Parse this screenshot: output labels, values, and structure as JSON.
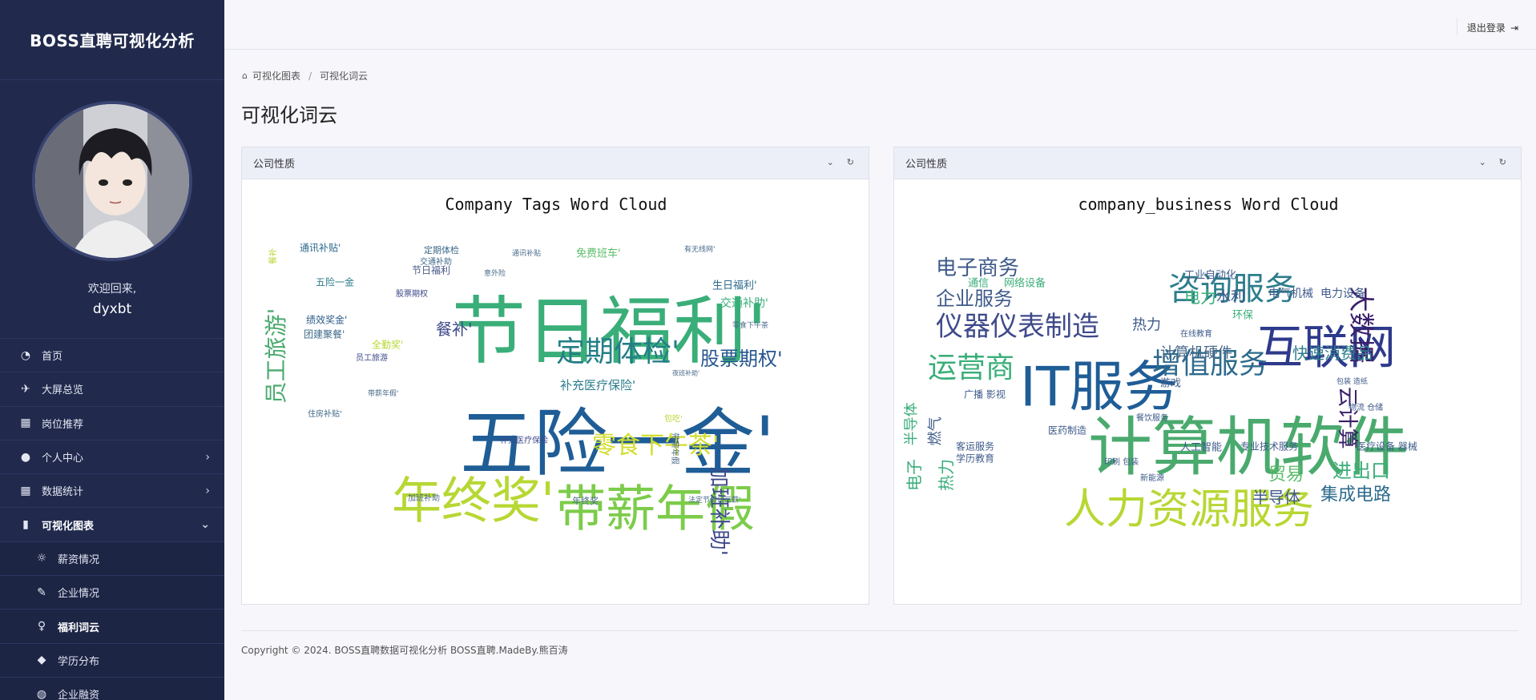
{
  "sidebar": {
    "brand": "BOSS直聘可视化分析",
    "welcome": "欢迎回来,",
    "username": "dyxbt",
    "items": [
      {
        "label": "首页",
        "icon": "dashboard-icon"
      },
      {
        "label": "大屏总览",
        "icon": "plane-icon"
      },
      {
        "label": "岗位推荐",
        "icon": "grid-icon"
      },
      {
        "label": "个人中心",
        "icon": "user-icon"
      },
      {
        "label": "数据统计",
        "icon": "grid-icon"
      },
      {
        "label": "可视化图表",
        "icon": "bar-chart-icon"
      }
    ],
    "subitems": [
      {
        "label": "薪资情况",
        "icon": "sun-icon"
      },
      {
        "label": "企业情况",
        "icon": "feather-icon"
      },
      {
        "label": "福利词云",
        "icon": "lightbulb-icon"
      },
      {
        "label": "学历分布",
        "icon": "graduation-cap-icon"
      },
      {
        "label": "企业融资",
        "icon": "globe-icon"
      }
    ]
  },
  "topbar": {
    "logout": "退出登录"
  },
  "breadcrumb": [
    "可视化图表",
    "可视化词云"
  ],
  "page_title": "可视化词云",
  "cards": [
    {
      "header": "公司性质",
      "title": "Company Tags Word Cloud",
      "words": [
        {
          "t": "节日福利'",
          "s": 92,
          "c": "#3aae79"
        },
        {
          "t": "五险一金'",
          "s": 92,
          "c": "#1f5d96"
        },
        {
          "t": "年终奖'",
          "s": 62,
          "c": "#b7d733"
        },
        {
          "t": "带薪年假",
          "s": 62,
          "c": "#7ccc4a"
        },
        {
          "t": "定期体检'",
          "s": 36,
          "c": "#237e86"
        },
        {
          "t": "零食下午茶'",
          "s": 30,
          "c": "#d2dd2b"
        },
        {
          "t": "股票期权'",
          "s": 24,
          "c": "#26568f"
        },
        {
          "t": "员工旅游'",
          "s": 28,
          "c": "#4aaa6e"
        },
        {
          "t": "加班补助'",
          "s": 26,
          "c": "#3e4a8a"
        },
        {
          "t": "餐补'",
          "s": 20,
          "c": "#3e4a8a"
        },
        {
          "t": "补充医疗保险'",
          "s": 15,
          "c": "#2d7d8c"
        },
        {
          "t": "交通补助'",
          "s": 14,
          "c": "#3aae79"
        },
        {
          "t": "生日福利'",
          "s": 13,
          "c": "#2d6a8c"
        },
        {
          "t": "免费班车'",
          "s": 13,
          "c": "#5bbd6a"
        },
        {
          "t": "通讯补贴'",
          "s": 12,
          "c": "#2d6a8c"
        },
        {
          "t": "全勤奖'",
          "s": 12,
          "c": "#b7d733"
        },
        {
          "t": "定期体检",
          "s": 11,
          "c": "#3e6a8a"
        },
        {
          "t": "绩效奖金'",
          "s": 12,
          "c": "#2d5a8a"
        },
        {
          "t": "团建聚餐'",
          "s": 12,
          "c": "#3e6a8a"
        },
        {
          "t": "五险一金",
          "s": 12,
          "c": "#2d7d8c"
        },
        {
          "t": "节日福利",
          "s": 12,
          "c": "#4a5a8a"
        },
        {
          "t": "年终奖",
          "s": 11,
          "c": "#4a6a8a"
        },
        {
          "t": "加班补助",
          "s": 10,
          "c": "#4a6a8a"
        },
        {
          "t": "带薪年假",
          "s": 10,
          "c": "#4a6a8a"
        },
        {
          "t": "法定节假日三薪'",
          "s": 9,
          "c": "#4a6a8a"
        },
        {
          "t": "补充医疗保险",
          "s": 10,
          "c": "#3e4a8a"
        },
        {
          "t": "股票期权",
          "s": 10,
          "c": "#3e4a8a"
        },
        {
          "t": "员工旅游",
          "s": 10,
          "c": "#3e4a8a"
        },
        {
          "t": "住房补贴'",
          "s": 10,
          "c": "#3e6a8a"
        },
        {
          "t": "交通补助",
          "s": 10,
          "c": "#3e6a8a"
        },
        {
          "t": "餐补",
          "s": 10,
          "c": "#b7d733"
        },
        {
          "t": "包吃'",
          "s": 10,
          "c": "#b7d733"
        },
        {
          "t": "意外险",
          "s": 9,
          "c": "#4a6a8a"
        },
        {
          "t": "有无线网'",
          "s": 9,
          "c": "#4a6a8a"
        },
        {
          "t": "零食下午茶",
          "s": 9,
          "c": "#4a6a8a"
        },
        {
          "t": "通讯补贴",
          "s": 9,
          "c": "#4a6a8a"
        },
        {
          "t": "带薪年假'",
          "s": 9,
          "c": "#4a6a8a"
        },
        {
          "t": "夜班补助'",
          "s": 8,
          "c": "#4a6a8a"
        }
      ]
    },
    {
      "header": "公司性质",
      "title": "company_business Word Cloud",
      "words": [
        {
          "t": "IT服务",
          "s": 68,
          "c": "#1f5d96"
        },
        {
          "t": "计算机软件",
          "s": 80,
          "c": "#4aaa6e"
        },
        {
          "t": "人力资源服务",
          "s": 52,
          "c": "#b7d733"
        },
        {
          "t": "互联网",
          "s": 58,
          "c": "#2d3a8c"
        },
        {
          "t": "咨询服务",
          "s": 40,
          "c": "#2d7d8c"
        },
        {
          "t": "仪器仪表制造",
          "s": 34,
          "c": "#3e4a8a"
        },
        {
          "t": "运营商",
          "s": 36,
          "c": "#3aae79"
        },
        {
          "t": "增值服务",
          "s": 36,
          "c": "#2d6a8c"
        },
        {
          "t": "电子商务",
          "s": 26,
          "c": "#3e5a8a"
        },
        {
          "t": "企业服务",
          "s": 24,
          "c": "#3e5a8a"
        },
        {
          "t": "大数据",
          "s": 32,
          "c": "#3a1f6a"
        },
        {
          "t": "云计算",
          "s": 26,
          "c": "#3a1f6a"
        },
        {
          "t": "快速消费品",
          "s": 20,
          "c": "#2d7d8c"
        },
        {
          "t": "计算机硬件",
          "s": 18,
          "c": "#4a6a8a"
        },
        {
          "t": "进出口",
          "s": 24,
          "c": "#3aae79"
        },
        {
          "t": "集成电路",
          "s": 22,
          "c": "#2d6a8c"
        },
        {
          "t": "半导体",
          "s": 20,
          "c": "#3e5a8a"
        },
        {
          "t": "贸易",
          "s": 22,
          "c": "#5bbd6a"
        },
        {
          "t": "电力",
          "s": 20,
          "c": "#3aae79"
        },
        {
          "t": "水利",
          "s": 18,
          "c": "#3e5a8a"
        },
        {
          "t": "热力",
          "s": 18,
          "c": "#3e5a8a"
        },
        {
          "t": "电气机械",
          "s": 14,
          "c": "#3e5a8a"
        },
        {
          "t": "电力设备",
          "s": 14,
          "c": "#3e5a8a"
        },
        {
          "t": "工业自动化",
          "s": 13,
          "c": "#3e5a8a"
        },
        {
          "t": "通信",
          "s": 13,
          "c": "#3aae79"
        },
        {
          "t": "网络设备",
          "s": 13,
          "c": "#3aae79"
        },
        {
          "t": "环保",
          "s": 13,
          "c": "#3aae79"
        },
        {
          "t": "人工智能",
          "s": 13,
          "c": "#3e5a8a"
        },
        {
          "t": "专业技术服务",
          "s": 12,
          "c": "#3e5a8a"
        },
        {
          "t": "医疗设备 器械",
          "s": 12,
          "c": "#3e5a8a"
        },
        {
          "t": "游戏",
          "s": 13,
          "c": "#3e5a8a"
        },
        {
          "t": "医药制造",
          "s": 12,
          "c": "#3e5a8a"
        },
        {
          "t": "客运服务",
          "s": 12,
          "c": "#3e5a8a"
        },
        {
          "t": "学历教育",
          "s": 12,
          "c": "#3e5a8a"
        },
        {
          "t": "广播 影视",
          "s": 12,
          "c": "#3e5a8a"
        },
        {
          "t": "半导体",
          "s": 18,
          "c": "#3aae79"
        },
        {
          "t": "电子",
          "s": 20,
          "c": "#3aae79"
        },
        {
          "t": "热力",
          "s": 20,
          "c": "#3aae79"
        },
        {
          "t": "燃气",
          "s": 18,
          "c": "#3e5a8a"
        },
        {
          "t": "在线教育",
          "s": 10,
          "c": "#3e5a8a"
        },
        {
          "t": "物流 仓储",
          "s": 10,
          "c": "#3e5a8a"
        },
        {
          "t": "包装 造纸",
          "s": 9,
          "c": "#3e5a8a"
        },
        {
          "t": "餐饮服务",
          "s": 10,
          "c": "#3e5a8a"
        },
        {
          "t": "新能源",
          "s": 10,
          "c": "#3e5a8a"
        },
        {
          "t": "印刷 包装",
          "s": 10,
          "c": "#3e5a8a"
        }
      ]
    }
  ],
  "footer": "Copyright © 2024. BOSS直聘数据可视化分析 BOSS直聘.MadeBy.熊百涛"
}
